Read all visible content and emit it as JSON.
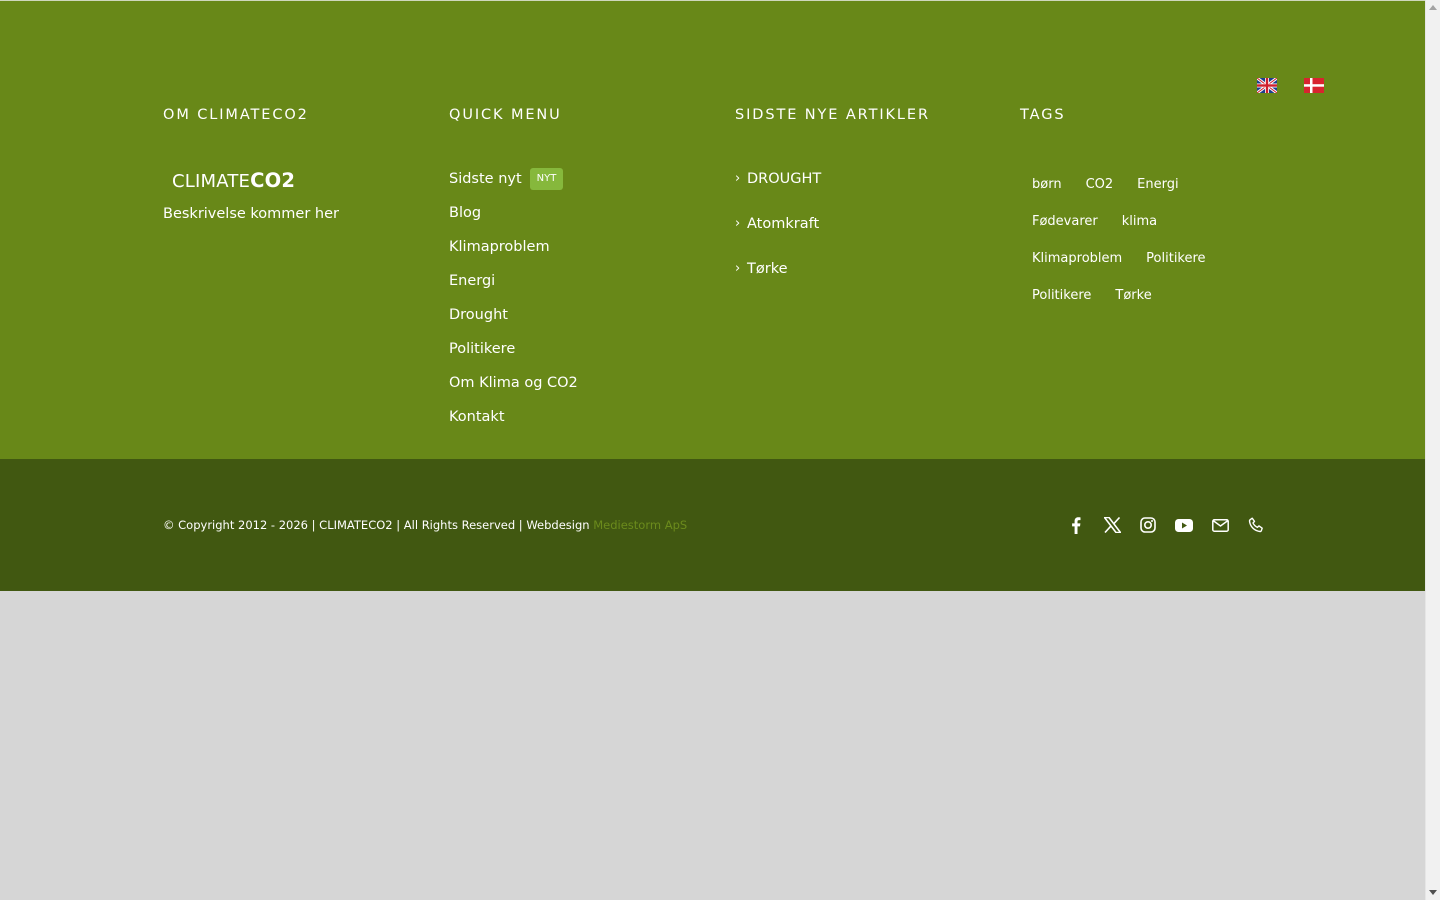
{
  "colors": {
    "footer_bg": "#688818",
    "copyright_bg": "#415811",
    "page_bg": "#d6d6d6",
    "badge_bg": "#86b83c",
    "credit_link": "#6b8b1c"
  },
  "language_switcher": {
    "flags": [
      {
        "icon": "uk-flag-icon",
        "lang": "English"
      },
      {
        "icon": "danish-flag-icon",
        "lang": "Dansk"
      }
    ]
  },
  "about": {
    "title": "OM CLIMATECO2",
    "logo_light": "CLIMATE",
    "logo_bold": "CO2",
    "description": "Beskrivelse kommer her"
  },
  "quick_menu": {
    "title": "QUICK MENU",
    "items": [
      {
        "label": "Sidste nyt",
        "badge": "NYT"
      },
      {
        "label": "Blog"
      },
      {
        "label": "Klimaproblem"
      },
      {
        "label": "Energi"
      },
      {
        "label": "Drought"
      },
      {
        "label": "Politikere"
      },
      {
        "label": "Om Klima og CO2"
      },
      {
        "label": "Kontakt"
      }
    ]
  },
  "recent_articles": {
    "title": "SIDSTE NYE ARTIKLER",
    "items": [
      "DROUGHT",
      "Atomkraft",
      "Tørke"
    ]
  },
  "tags": {
    "title": "TAGS",
    "items": [
      "børn",
      "CO2",
      "Energi",
      "Fødevarer",
      "klima",
      "Klimaproblem",
      "Politikere",
      "Politikere",
      "Tørke"
    ]
  },
  "copyright": {
    "text": "© Copyright 2012 - 2026 | CLIMATECO2 | All Rights Reserved | Webdesign ",
    "credit": "Mediestorm ApS"
  },
  "socials": [
    "facebook-icon",
    "x-twitter-icon",
    "instagram-icon",
    "youtube-icon",
    "mail-icon",
    "phone-icon"
  ]
}
